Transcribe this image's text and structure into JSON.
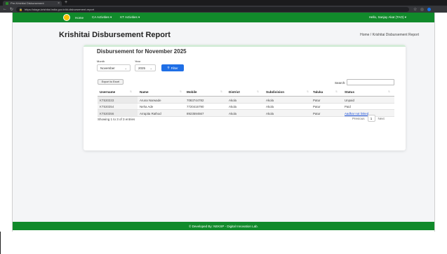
{
  "browser": {
    "tab_title": "Pre-Krishitai Disbursement",
    "url": "https://stage-krishitai.india.gov.in/kt-disbursement-report"
  },
  "nav": {
    "home": "Home",
    "ca_activities": "CA Activities ▾",
    "kt_activities": "KT Activities ▾",
    "user": "Hello, Sanjay Akat (TAO) ▾"
  },
  "page": {
    "title": "Krishitai Disbursement Report",
    "breadcrumb": "Home / Krishitai Disbursement Report"
  },
  "card": {
    "title": "Disbursement for November 2025",
    "month_label": "Month",
    "month_value": "November",
    "year_label": "Year",
    "year_value": "2025",
    "filter_label": "Filter",
    "export_label": "Export to Excel",
    "search_label": "Search:"
  },
  "table": {
    "headers": [
      "Username",
      "Name",
      "Mobile",
      "District",
      "Subdivision",
      "Taluka",
      "Status"
    ],
    "rows": [
      [
        "KT530333",
        "Aruna Narwade",
        "7083744782",
        "Akola",
        "Akola",
        "Patur",
        "Unpaid"
      ],
      [
        "KT530354",
        "Neha Ade",
        "7720416790",
        "Akola",
        "Akola",
        "Patur",
        "Paid"
      ],
      [
        "KT530356",
        "Arrapita Rathod",
        "8923594567",
        "Akola",
        "Akola",
        "Patur",
        "Aadhar not linked"
      ]
    ],
    "info": "Showing 1 to 3 of 3 entries",
    "pagination": {
      "previous": "Previous",
      "page": "1",
      "next": "Next"
    }
  },
  "footer": {
    "text": "© Developed By: NEKSP - Digital Innovation Lab."
  },
  "colors": {
    "brand_green": "#118a2b",
    "filter_blue": "#1f6fe6",
    "link_blue": "#1a4fd8"
  }
}
